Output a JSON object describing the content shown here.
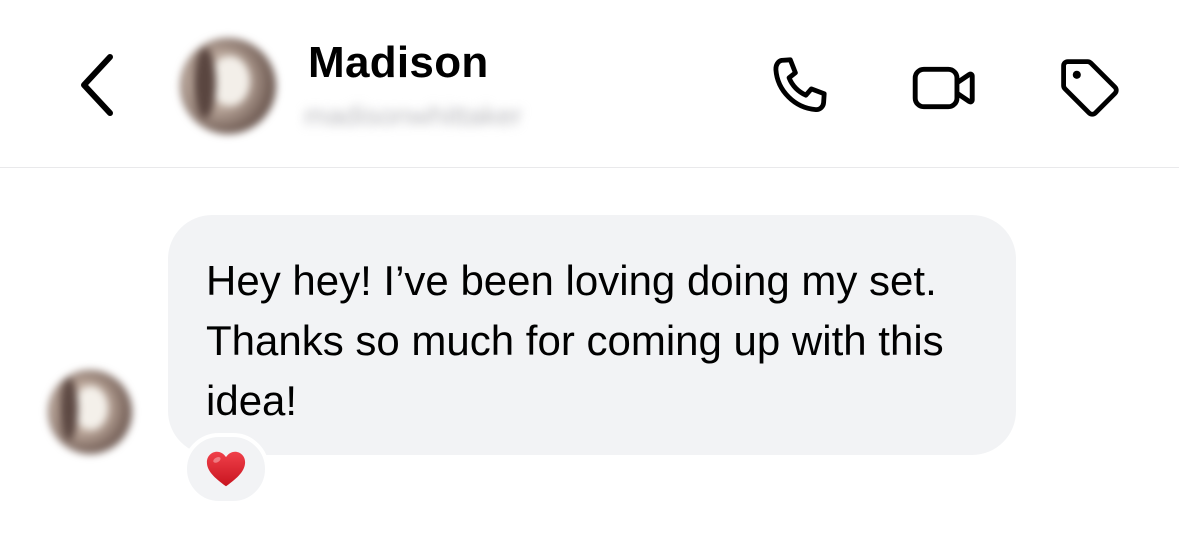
{
  "header": {
    "contact_name": "Madison",
    "contact_handle": "madisonwhittaker",
    "icons": {
      "back": "chevron-left-icon",
      "phone": "phone-icon",
      "video": "video-camera-icon",
      "tag": "tag-icon"
    }
  },
  "conversation": {
    "messages": [
      {
        "from": "Madison",
        "text": "Hey hey! I’ve been loving doing my set. Thanks so much for coming up with this idea!",
        "reaction": {
          "icon": "red-heart-icon",
          "color": "#e0202b"
        }
      }
    ]
  },
  "colors": {
    "bubble_background": "#f2f3f5",
    "divider": "#e9e9eb",
    "icon_stroke": "#000000"
  }
}
